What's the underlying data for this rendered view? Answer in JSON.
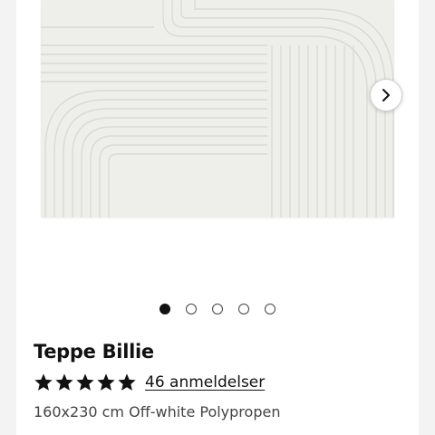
{
  "product": {
    "title": "Teppe Billie",
    "rating": {
      "stars": 5,
      "review_link": "46 anmeldelser"
    },
    "description": "160x230 cm Off-white Polypropen"
  },
  "gallery": {
    "image_count": 5,
    "active_index": 0,
    "next_icon": "chevron-right-icon"
  },
  "colors": {
    "rug": "#eeeeeb",
    "accent": "#111111"
  }
}
